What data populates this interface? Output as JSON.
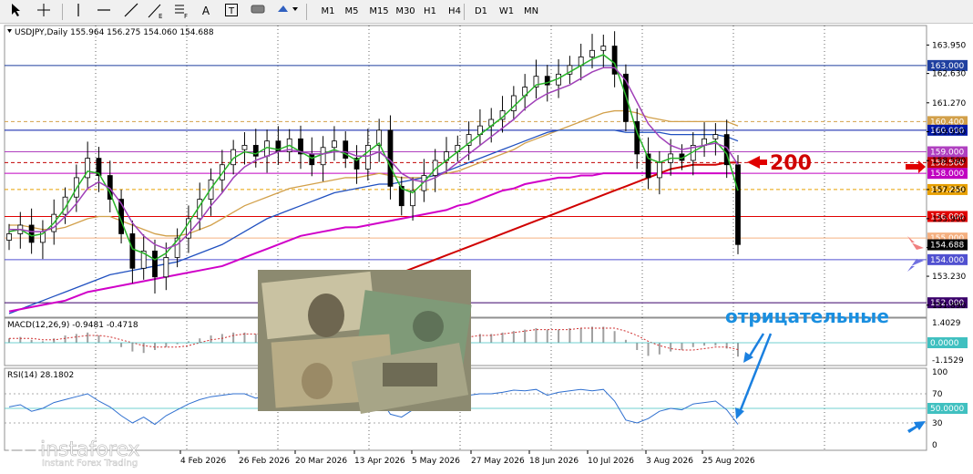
{
  "toolbar": {
    "icons": [
      "cursor-icon",
      "crosshair-icon",
      "vertical-line-icon",
      "horizontal-line-icon",
      "trendline-icon",
      "fibonacci-icon",
      "fibo-fan-icon",
      "text-icon",
      "text-label-icon",
      "rectangle-icon",
      "shapes-menu-icon"
    ],
    "text_tool_label": "A",
    "timeframes": [
      "M1",
      "M5",
      "M15",
      "M30",
      "H1",
      "H4",
      "D1",
      "W1",
      "MN"
    ]
  },
  "chart_data": {
    "type": "candlestick",
    "symbol_line": "USDJPY,Daily  155.964 156.275 154.060 154.688",
    "yaxis_ticks": [
      "163.950",
      "162.630",
      "161.270",
      "159.930",
      "158.590",
      "157.250",
      "155.900",
      "154.560",
      "153.230",
      "151.890"
    ],
    "xaxis_ticks": [
      "4 Feb 2026",
      "26 Feb 2026",
      "20 Mar 2026",
      "13 Apr 2026",
      "5 May 2026",
      "27 May 2026",
      "18 Jun 2026",
      "10 Jul 2026",
      "3 Aug 2026",
      "25 Aug 2026"
    ],
    "levels": [
      {
        "value": 163.0,
        "label": "163.000",
        "color": "#1f3f9f",
        "style": "solid"
      },
      {
        "value": 160.4,
        "label": "160.400",
        "color": "#d2a04a",
        "style": "dashed"
      },
      {
        "value": 160.0,
        "label": "160.000",
        "color": "#0018a8",
        "style": "solid"
      },
      {
        "value": 159.0,
        "label": "159.000",
        "color": "#b040c0",
        "style": "solid"
      },
      {
        "value": 158.5,
        "label": "158.500",
        "color": "#c00000",
        "style": "dashed"
      },
      {
        "value": 158.0,
        "label": "158.000",
        "color": "#c000c0",
        "style": "solid"
      },
      {
        "value": 157.25,
        "label": "157.250",
        "color": "#e8a000",
        "style": "dashed"
      },
      {
        "value": 156.0,
        "label": "156.000",
        "color": "#e00000",
        "style": "solid"
      },
      {
        "value": 155.0,
        "label": "155.000",
        "color": "#f5b080",
        "style": "solid"
      },
      {
        "value": 154.0,
        "label": "154.000",
        "color": "#5050d0",
        "style": "solid"
      },
      {
        "value": 152.0,
        "label": "152.000",
        "color": "#3a006a",
        "style": "solid"
      }
    ],
    "current_price": "154.688",
    "ylim": [
      151.5,
      164.6
    ],
    "series": [
      {
        "name": "USDJPY",
        "values": [
          155.2,
          155.6,
          154.8,
          155.3,
          156.1,
          156.9,
          157.8,
          158.7,
          157.9,
          156.8,
          155.2,
          153.6,
          154.4,
          153.2,
          154.1,
          155.0,
          155.9,
          156.8,
          157.7,
          158.4,
          159.1,
          159.3,
          158.8,
          159.5,
          159.0,
          159.6,
          158.9,
          158.4,
          159.2,
          159.5,
          158.7,
          158.2,
          159.3,
          160.0,
          157.4,
          156.5,
          157.2,
          157.9,
          158.6,
          159.0,
          159.3,
          159.8,
          160.2,
          160.5,
          160.9,
          161.6,
          162.0,
          162.5,
          162.1,
          162.6,
          163.0,
          163.4,
          163.7,
          163.9,
          162.6,
          160.4,
          158.9,
          157.8,
          158.5,
          158.9,
          158.6,
          159.3,
          159.6,
          159.8,
          158.4,
          154.7
        ]
      },
      {
        "name": "ma-green",
        "values": [
          155.3,
          155.4,
          155.1,
          155.2,
          155.7,
          156.4,
          157.3,
          158.1,
          158.0,
          157.1,
          155.8,
          154.5,
          154.3,
          154.0,
          154.3,
          154.9,
          155.7,
          156.5,
          157.3,
          158.0,
          158.7,
          159.0,
          158.9,
          159.2,
          159.1,
          159.3,
          159.0,
          158.7,
          158.9,
          159.1,
          158.9,
          158.6,
          159.0,
          159.4,
          158.3,
          157.3,
          157.1,
          157.6,
          158.2,
          158.6,
          159.0,
          159.4,
          159.8,
          160.2,
          160.6,
          161.1,
          161.6,
          162.1,
          162.2,
          162.4,
          162.7,
          163.0,
          163.3,
          163.5,
          163.1,
          161.6,
          159.9,
          158.7,
          158.5,
          158.7,
          158.7,
          159.0,
          159.3,
          159.5,
          158.9,
          157.2
        ]
      },
      {
        "name": "ma-purple",
        "values": [
          155.4,
          155.4,
          155.3,
          155.3,
          155.5,
          156.0,
          156.6,
          157.3,
          157.6,
          157.3,
          156.6,
          155.7,
          155.1,
          154.7,
          154.5,
          154.7,
          155.2,
          155.8,
          156.5,
          157.1,
          157.8,
          158.3,
          158.6,
          158.8,
          159.0,
          159.1,
          159.0,
          158.9,
          158.9,
          159.0,
          159.0,
          158.8,
          158.8,
          159.0,
          158.6,
          158.0,
          157.7,
          157.6,
          157.8,
          158.1,
          158.5,
          158.9,
          159.3,
          159.7,
          160.1,
          160.5,
          161.0,
          161.4,
          161.7,
          161.9,
          162.1,
          162.4,
          162.7,
          162.9,
          162.9,
          162.3,
          161.3,
          160.3,
          159.7,
          159.3,
          159.1,
          159.2,
          159.3,
          159.4,
          159.2,
          158.4
        ]
      }
    ],
    "ma_long": [
      {
        "name": "ma-orange",
        "values": [
          155.6,
          155.6,
          155.5,
          155.4,
          155.4,
          155.5,
          155.7,
          155.9,
          156.0,
          156.0,
          155.8,
          155.6,
          155.4,
          155.2,
          155.1,
          155.1,
          155.2,
          155.4,
          155.6,
          155.9,
          156.2,
          156.5,
          156.7,
          156.9,
          157.1,
          157.3,
          157.4,
          157.5,
          157.6,
          157.7,
          157.8,
          157.8,
          157.9,
          158.0,
          157.9,
          157.8,
          157.8,
          157.8,
          157.9,
          158.0,
          158.1,
          158.3,
          158.5,
          158.7,
          158.9,
          159.1,
          159.4,
          159.6,
          159.8,
          160.0,
          160.2,
          160.4,
          160.6,
          160.8,
          160.9,
          160.9,
          160.8,
          160.6,
          160.5,
          160.4,
          160.4,
          160.4,
          160.4,
          160.4,
          160.4,
          160.2
        ]
      },
      {
        "name": "ma-blue",
        "values": [
          151.5,
          151.7,
          151.9,
          152.1,
          152.3,
          152.5,
          152.7,
          152.9,
          153.1,
          153.3,
          153.4,
          153.5,
          153.6,
          153.7,
          153.8,
          153.9,
          154.1,
          154.3,
          154.5,
          154.7,
          155.0,
          155.3,
          155.6,
          155.9,
          156.1,
          156.3,
          156.5,
          156.7,
          156.9,
          157.1,
          157.2,
          157.3,
          157.4,
          157.5,
          157.5,
          157.6,
          157.7,
          157.8,
          157.9,
          158.1,
          158.3,
          158.5,
          158.7,
          158.9,
          159.1,
          159.3,
          159.5,
          159.7,
          159.9,
          160.0,
          160.0,
          160.0,
          160.0,
          160.0,
          160.0,
          159.9,
          159.9,
          159.9,
          159.9,
          159.8,
          159.8,
          159.8,
          159.8,
          159.8,
          159.7,
          159.5
        ]
      },
      {
        "name": "ma-magenta",
        "values": [
          151.6,
          151.7,
          151.8,
          151.9,
          152.0,
          152.1,
          152.3,
          152.5,
          152.6,
          152.7,
          152.8,
          152.9,
          153.0,
          153.1,
          153.2,
          153.3,
          153.4,
          153.5,
          153.6,
          153.7,
          153.9,
          154.1,
          154.3,
          154.5,
          154.7,
          154.9,
          155.1,
          155.2,
          155.3,
          155.4,
          155.5,
          155.5,
          155.6,
          155.7,
          155.8,
          155.9,
          156.0,
          156.1,
          156.2,
          156.3,
          156.5,
          156.6,
          156.8,
          157.0,
          157.2,
          157.3,
          157.5,
          157.6,
          157.7,
          157.8,
          157.8,
          157.9,
          157.9,
          158.0,
          158.0,
          158.0,
          158.0,
          158.0,
          158.0,
          158.0,
          158.0,
          158.0,
          158.0,
          158.0,
          158.0,
          158.0
        ]
      }
    ],
    "ma200": [
      152.2,
      152.4,
      152.6,
      152.8,
      153.0,
      153.2,
      153.4,
      153.6,
      153.8,
      154.0,
      154.2,
      154.4,
      154.6,
      154.8,
      155.0,
      155.2,
      155.4,
      155.6,
      155.8,
      156.0,
      156.2,
      156.4,
      156.6,
      156.8,
      157.0,
      157.2,
      157.4,
      157.6,
      157.8,
      158.0,
      158.2,
      158.3,
      158.4,
      158.4,
      158.4,
      158.5,
      158.5
    ],
    "ma200_start_index": 29,
    "macd": {
      "label": "MACD(12,26,9) -0.9481 -0.4718",
      "ticks": [
        "1.4029",
        "0.0000",
        "-1.1529"
      ],
      "values": [
        0.3,
        0.4,
        0.2,
        0.1,
        0.3,
        0.5,
        0.6,
        0.7,
        0.5,
        0.2,
        -0.3,
        -0.6,
        -0.7,
        -0.5,
        -0.3,
        -0.1,
        0.1,
        0.3,
        0.5,
        0.6,
        0.7,
        0.7,
        0.6,
        0.6,
        0.5,
        0.5,
        0.4,
        0.3,
        0.4,
        0.4,
        0.3,
        0.2,
        0.3,
        0.4,
        0.1,
        -0.2,
        -0.2,
        0.0,
        0.2,
        0.3,
        0.4,
        0.5,
        0.6,
        0.6,
        0.7,
        0.8,
        0.9,
        1.0,
        0.9,
        0.9,
        1.0,
        1.0,
        1.1,
        1.1,
        0.8,
        0.2,
        -0.5,
        -0.9,
        -0.8,
        -0.6,
        -0.5,
        -0.3,
        -0.2,
        -0.2,
        -0.4,
        -0.95
      ],
      "signal": [
        0.3,
        0.3,
        0.3,
        0.2,
        0.2,
        0.3,
        0.4,
        0.5,
        0.5,
        0.4,
        0.2,
        0.0,
        -0.2,
        -0.3,
        -0.3,
        -0.3,
        -0.2,
        0.0,
        0.2,
        0.3,
        0.5,
        0.6,
        0.6,
        0.6,
        0.6,
        0.5,
        0.5,
        0.4,
        0.4,
        0.4,
        0.4,
        0.3,
        0.3,
        0.3,
        0.2,
        0.1,
        0.0,
        0.0,
        0.1,
        0.2,
        0.3,
        0.4,
        0.5,
        0.5,
        0.6,
        0.7,
        0.8,
        0.9,
        0.9,
        0.9,
        0.9,
        1.0,
        1.0,
        1.0,
        1.0,
        0.8,
        0.5,
        0.1,
        -0.2,
        -0.4,
        -0.5,
        -0.5,
        -0.4,
        -0.3,
        -0.3,
        -0.47
      ]
    },
    "rsi": {
      "label": "RSI(14) 28.1802",
      "ticks": [
        "100",
        "70",
        "50",
        "30",
        "0"
      ],
      "values": [
        52,
        55,
        46,
        50,
        58,
        62,
        66,
        70,
        60,
        52,
        40,
        30,
        38,
        28,
        40,
        48,
        56,
        62,
        66,
        68,
        70,
        70,
        64,
        68,
        62,
        66,
        58,
        54,
        60,
        62,
        54,
        50,
        60,
        66,
        42,
        38,
        48,
        56,
        62,
        64,
        66,
        68,
        70,
        70,
        72,
        75,
        74,
        76,
        68,
        72,
        74,
        76,
        74,
        76,
        60,
        34,
        30,
        36,
        46,
        50,
        48,
        56,
        58,
        60,
        48,
        28
      ]
    },
    "annotations": {
      "arrow_200": "200",
      "negative_label": "отрицательные"
    }
  },
  "watermark": {
    "brand": "instaforex",
    "tagline": "Instant Forex Trading"
  }
}
